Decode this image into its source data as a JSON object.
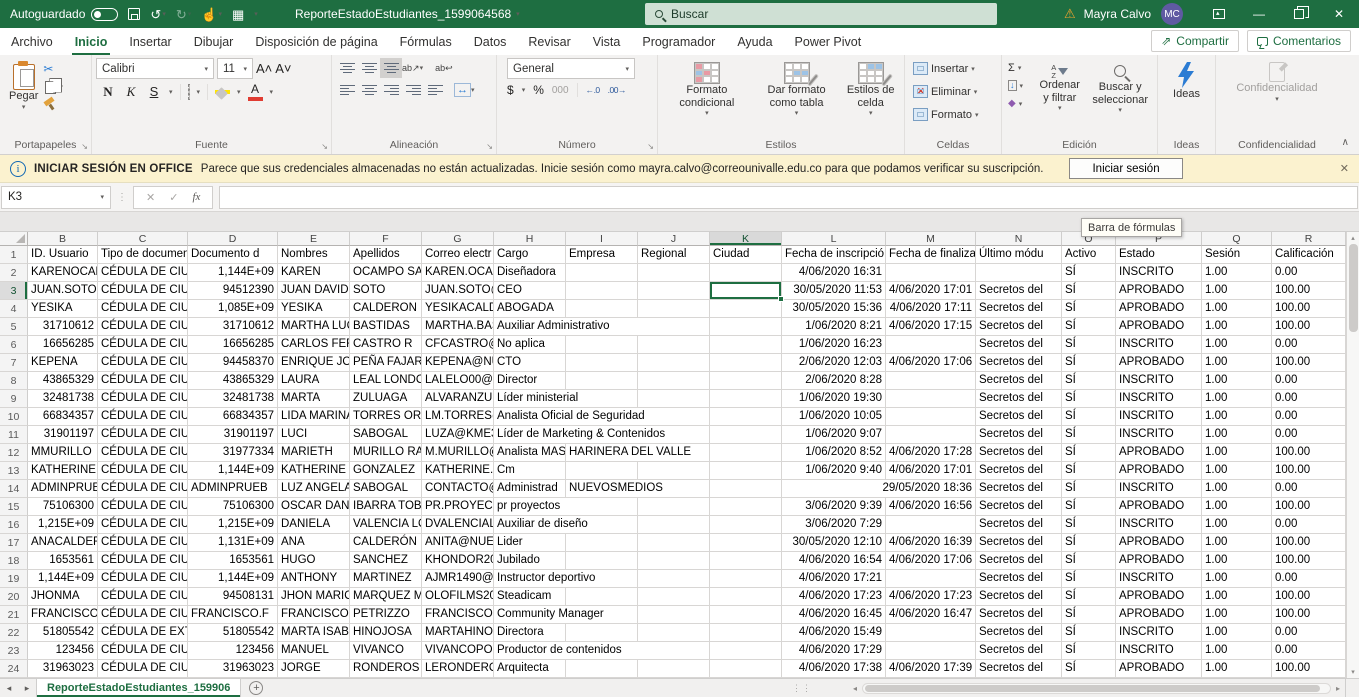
{
  "titlebar": {
    "autosave_label": "Autoguardado",
    "workbook_title": "ReporteEstadoEstudiantes_1599064568",
    "search_placeholder": "Buscar",
    "user_name": "Mayra Calvo",
    "user_initials": "MC"
  },
  "tabs": {
    "items": [
      "Archivo",
      "Inicio",
      "Insertar",
      "Dibujar",
      "Disposición de página",
      "Fórmulas",
      "Datos",
      "Revisar",
      "Vista",
      "Programador",
      "Ayuda",
      "Power Pivot"
    ],
    "active_index": 1,
    "share_label": "Compartir",
    "comments_label": "Comentarios"
  },
  "ribbon": {
    "paste_label": "Pegar",
    "font_name": "Calibri",
    "font_size": "11",
    "bold": "N",
    "italic": "K",
    "underline": "S",
    "number_format": "General",
    "conditional_label": "Formato condicional",
    "format_table_label": "Dar formato como tabla",
    "cell_styles_label": "Estilos de celda",
    "insert_label": "Insertar",
    "delete_label": "Eliminar",
    "format_label": "Formato",
    "sort_label": "Ordenar y filtrar",
    "find_label": "Buscar y seleccionar",
    "ideas_label": "Ideas",
    "sensitivity_label": "Confidencialidad",
    "groups": [
      "Portapapeles",
      "Fuente",
      "Alineación",
      "Número",
      "Estilos",
      "Celdas",
      "Edición",
      "Ideas",
      "Confidencialidad"
    ]
  },
  "notification": {
    "title": "INICIAR SESIÓN EN OFFICE",
    "message": "Parece que sus credenciales almacenadas no están actualizadas. Inicie sesión como mayra.calvo@correounivalle.edu.co para que podamos verificar su suscripción.",
    "action_label": "Iniciar sesión"
  },
  "formula_bar": {
    "name_box": "K3",
    "value": ""
  },
  "tooltip": "Barra de fórmulas",
  "sheet": {
    "col_letters": [
      "B",
      "C",
      "D",
      "E",
      "F",
      "G",
      "H",
      "I",
      "J",
      "K",
      "L",
      "M",
      "N",
      "O",
      "P",
      "Q",
      "R"
    ],
    "selected_cell": "K3",
    "rows": [
      [
        "ID. Usuario",
        "Tipo de documen",
        "Documento d",
        "Nombres",
        "Apellidos",
        "Correo electr",
        "Cargo",
        "Empresa",
        "Regional",
        "Ciudad",
        "Fecha de inscripció",
        "Fecha de finalizac",
        "Último módu",
        "Activo",
        "Estado",
        "Sesión",
        "Calificación"
      ],
      [
        "KARENOCAM",
        "CÉDULA DE CIUDA",
        "1,144E+09",
        "KAREN",
        "OCAMPO SAL",
        "KAREN.OCAM",
        "Diseñadora",
        "",
        "",
        "",
        "4/06/2020 16:31",
        "",
        "",
        "SÍ",
        "INSCRITO",
        "1.00",
        "0.00"
      ],
      [
        "JUAN.SOTO",
        "CÉDULA DE CIUDA",
        "94512390",
        "JUAN DAVID",
        "SOTO",
        "JUAN.SOTO@",
        "CEO",
        "",
        "",
        "",
        "30/05/2020 11:53",
        "4/06/2020 17:01",
        "Secretos del",
        "SÍ",
        "APROBADO",
        "1.00",
        "100.00"
      ],
      [
        "YESIKA",
        "CÉDULA DE CIUDA",
        "1,085E+09",
        "YESIKA",
        "CALDERON",
        "YESIKACALDE",
        "ABOGADA",
        "",
        "",
        "",
        "30/05/2020 15:36",
        "4/06/2020 17:11",
        "Secretos del",
        "SÍ",
        "APROBADO",
        "1.00",
        "100.00"
      ],
      [
        "31710612",
        "CÉDULA DE CIUDA",
        "31710612",
        "MARTHA LUC",
        "BASTIDAS",
        "MARTHA.BAS",
        "Auxiliar Administrativo",
        "",
        "",
        "",
        "1/06/2020 8:21",
        "4/06/2020 17:15",
        "Secretos del",
        "SÍ",
        "APROBADO",
        "1.00",
        "100.00"
      ],
      [
        "16656285",
        "CÉDULA DE CIUDA",
        "16656285",
        "CARLOS FERN",
        "CASTRO R",
        "CFCASTRO@",
        "No aplica",
        "",
        "",
        "",
        "1/06/2020 16:23",
        "",
        "Secretos del",
        "SÍ",
        "INSCRITO",
        "1.00",
        "0.00"
      ],
      [
        "KEPENA",
        "CÉDULA DE CIUDA",
        "94458370",
        "ENRIQUE JOS",
        "PEÑA FAJARD",
        "KEPENA@NU",
        "CTO",
        "",
        "",
        "",
        "2/06/2020 12:03",
        "4/06/2020 17:06",
        "Secretos del",
        "SÍ",
        "APROBADO",
        "1.00",
        "100.00"
      ],
      [
        "43865329",
        "CÉDULA DE CIUDA",
        "43865329",
        "LAURA",
        "LEAL LONDOÑ",
        "LALELO00@H",
        "Director",
        "",
        "",
        "",
        "2/06/2020 8:28",
        "",
        "Secretos del",
        "SÍ",
        "INSCRITO",
        "1.00",
        "0.00"
      ],
      [
        "32481738",
        "CÉDULA DE CIUDA",
        "32481738",
        "MARTA",
        "ZULUAGA",
        "ALVARANZUL",
        "Líder ministerial",
        "",
        "",
        "",
        "1/06/2020 19:30",
        "",
        "Secretos del",
        "SÍ",
        "INSCRITO",
        "1.00",
        "0.00"
      ],
      [
        "66834357",
        "CÉDULA DE CIUDA",
        "66834357",
        "LIDA MARINA",
        "TORRES ORD",
        "LM.TORRES@",
        "Analista Oficial de Seguridad",
        "",
        "",
        "",
        "1/06/2020 10:05",
        "",
        "Secretos del",
        "SÍ",
        "INSCRITO",
        "1.00",
        "0.00"
      ],
      [
        "31901197",
        "CÉDULA DE CIUDA",
        "31901197",
        "LUCI",
        "SABOGAL",
        "LUZA@KME3",
        "Líder de Marketing & Contenidos",
        "",
        "",
        "",
        "1/06/2020 9:07",
        "",
        "Secretos del",
        "SÍ",
        "INSCRITO",
        "1.00",
        "0.00"
      ],
      [
        "MMURILLO",
        "CÉDULA DE CIUDA",
        "31977334",
        "MARIETH",
        "MURILLO RAI",
        "M.MURILLO@",
        "Analista MAS",
        "HARINERA DEL VALLE",
        "",
        "",
        "1/06/2020 8:52",
        "4/06/2020 17:28",
        "Secretos del",
        "SÍ",
        "APROBADO",
        "1.00",
        "100.00"
      ],
      [
        "KATHERINE.G",
        "CÉDULA DE CIUDA",
        "1,144E+09",
        "KATHERINE",
        "GONZALEZ",
        "KATHERINE.G",
        "Cm",
        "",
        "",
        "",
        "1/06/2020 9:40",
        "4/06/2020 17:01",
        "Secretos del",
        "SÍ",
        "APROBADO",
        "1.00",
        "100.00"
      ],
      [
        "ADMINPRUEB",
        "CÉDULA DE CIUDA",
        "ADMINPRUEB",
        "LUZ ANGELA",
        "SABOGAL",
        "CONTACTO@",
        "Administrad",
        "NUEVOSMEDIOS",
        "",
        "",
        "29/05/2020 18:36",
        "",
        "Secretos del",
        "SÍ",
        "INSCRITO",
        "1.00",
        "0.00"
      ],
      [
        "75106300",
        "CÉDULA DE CIUDA",
        "75106300",
        "OSCAR DANIE",
        "IBARRA TOBA",
        "PR.PROYECTO",
        "pr proyectos",
        "",
        "",
        "",
        "3/06/2020 9:39",
        "4/06/2020 16:56",
        "Secretos del",
        "SÍ",
        "APROBADO",
        "1.00",
        "100.00"
      ],
      [
        "1,215E+09",
        "CÉDULA DE CIUDA",
        "1,215E+09",
        "DANIELA",
        "VALENCIA LÓ",
        "DVALENCIALO",
        "Auxiliar de diseño",
        "",
        "",
        "",
        "3/06/2020 7:29",
        "",
        "Secretos del",
        "SÍ",
        "INSCRITO",
        "1.00",
        "0.00"
      ],
      [
        "ANACALDERO",
        "CÉDULA DE CIUDA",
        "1,131E+09",
        "ANA",
        "CALDERÓN FL",
        "ANITA@NUEV",
        "Lider",
        "",
        "",
        "",
        "30/05/2020 12:10",
        "4/06/2020 16:39",
        "Secretos del",
        "SÍ",
        "APROBADO",
        "1.00",
        "100.00"
      ],
      [
        "1653561",
        "CÉDULA DE CIUDA",
        "1653561",
        "HUGO",
        "SANCHEZ",
        "KHONDOR20",
        "Jubilado",
        "",
        "",
        "",
        "4/06/2020 16:54",
        "4/06/2020 17:06",
        "Secretos del",
        "SÍ",
        "APROBADO",
        "1.00",
        "100.00"
      ],
      [
        "1,144E+09",
        "CÉDULA DE CIUDA",
        "1,144E+09",
        "ANTHONY",
        "MARTINEZ",
        "AJMR1490@",
        "Instructor deportivo",
        "",
        "",
        "",
        "4/06/2020 17:21",
        "",
        "Secretos del",
        "SÍ",
        "INSCRITO",
        "1.00",
        "0.00"
      ],
      [
        "JHONMA",
        "CÉDULA DE CIUDA",
        "94508131",
        "JHON MARIO",
        "MARQUEZ M",
        "OLOFILMS20",
        "Steadicam",
        "",
        "",
        "",
        "4/06/2020 17:23",
        "4/06/2020 17:23",
        "Secretos del",
        "SÍ",
        "APROBADO",
        "1.00",
        "100.00"
      ],
      [
        "FRANCISCO.F",
        "CÉDULA DE CIUDA",
        "FRANCISCO.F",
        "FRANCISCO",
        "PETRIZZO",
        "FRANCISCO.F",
        "Community Manager",
        "",
        "",
        "",
        "4/06/2020 16:45",
        "4/06/2020 16:47",
        "Secretos del",
        "SÍ",
        "APROBADO",
        "1.00",
        "100.00"
      ],
      [
        "51805542",
        "CÉDULA DE EXTRA",
        "51805542",
        "MARTA ISABE",
        "HINOJOSA",
        "MARTAHINO.",
        "Directora",
        "",
        "",
        "",
        "4/06/2020 15:49",
        "",
        "Secretos del",
        "SÍ",
        "INSCRITO",
        "1.00",
        "0.00"
      ],
      [
        "123456",
        "CÉDULA DE CIUDA",
        "123456",
        "MANUEL",
        "VIVANCO",
        "VIVANCOPOR",
        "Productor de contenidos",
        "",
        "",
        "",
        "4/06/2020 17:29",
        "",
        "Secretos del",
        "SÍ",
        "INSCRITO",
        "1.00",
        "0.00"
      ],
      [
        "31963023",
        "CÉDULA DE CIUDA",
        "31963023",
        "JORGE",
        "RONDEROS",
        "LERONDEROS",
        "Arquitecta",
        "",
        "",
        "",
        "4/06/2020 17:38",
        "4/06/2020 17:39",
        "Secretos del",
        "SÍ",
        "APROBADO",
        "1.00",
        "100.00"
      ]
    ]
  },
  "sheet_tabbar": {
    "active_tab": "ReporteEstadoEstudiantes_159906"
  },
  "icons": {
    "scissors": "✂",
    "undo": "↺",
    "redo": "↻",
    "touch": "☝",
    "grid": "▦",
    "dropdown": "▾",
    "warning": "⚠",
    "minimize": "—",
    "close": "✕",
    "share_arrow": "⇗",
    "launcher": "↘",
    "sum": "Σ",
    "dollar": "$",
    "percent": "%",
    "thousands": "000",
    "dec_inc": "←.0",
    "dec_dec": ".00→",
    "wrap": "ab↩",
    "orient": "ab↗",
    "merge": "↔",
    "check": "✓",
    "cancel": "✕",
    "fx": "fx",
    "dots": "⋮",
    "fill_down": "↓",
    "eraser": "◆",
    "az_a": "A",
    "az_z": "Z",
    "info": "i",
    "collapse": "∧",
    "nav_left": "◂",
    "nav_right": "▸",
    "plus": "+",
    "up": "▴",
    "down": "▾",
    "split_dots": "⋮⋮"
  }
}
